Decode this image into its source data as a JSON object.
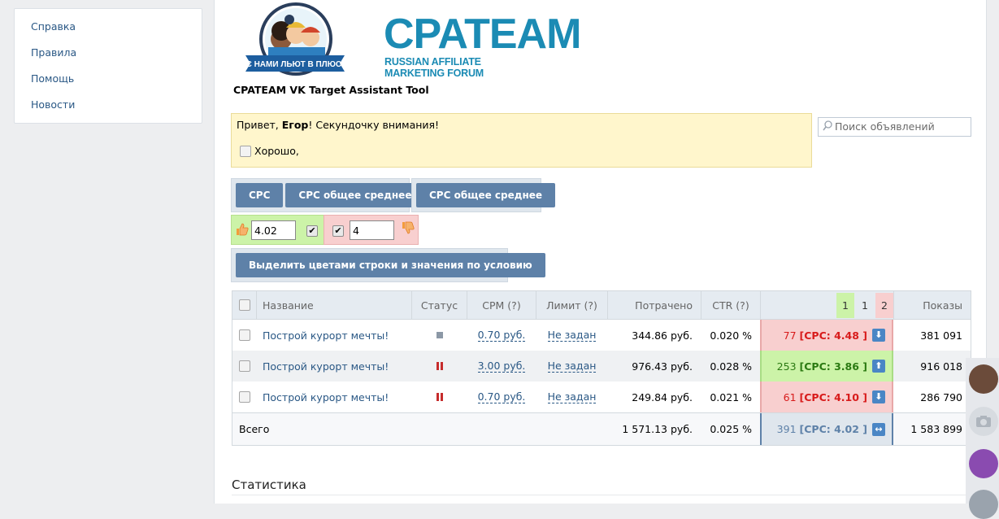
{
  "leftnav": {
    "items": [
      {
        "label": "Справка"
      },
      {
        "label": "Правила"
      },
      {
        "label": "Помощь"
      },
      {
        "label": "Новости"
      }
    ]
  },
  "logo": {
    "brand": "CPATEAM",
    "subtitle": "RUSSIAN AFFILIATE MARKETING FORUM",
    "ribbon": "С НАМИ ЛЬЮТ В ПЛЮС!"
  },
  "tool_title": "CPATEAM VK Target Assistant Tool",
  "notice": {
    "greeting_prefix": "Привет, ",
    "name": "Егор",
    "greeting_suffix": "! Секундочку внимания!",
    "ok_label": "Хорошо,"
  },
  "search": {
    "placeholder": "Поиск объявлений"
  },
  "buttons": {
    "cpc": "CPC",
    "cpc_avg": "CPC общее среднее",
    "cpc_avg2": "CPC общее среднее",
    "highlight": "Выделить цветами строки и значения по условию"
  },
  "thresholds": {
    "good_value": "4.02",
    "bad_value": "4"
  },
  "table": {
    "headers": {
      "name": "Название",
      "status": "Статус",
      "cpm": "CPM (?)",
      "limit": "Лимит (?)",
      "spent": "Потрачено",
      "ctr": "CTR (?)",
      "bid_tabs": [
        "1",
        "1",
        "2"
      ],
      "views": "Показы"
    },
    "rows": [
      {
        "name": "Построй курорт мечты!",
        "status": "stopped",
        "cpm": "0.70 руб.",
        "limit": "Не задан",
        "spent": "344.86 руб.",
        "ctr": "0.020 %",
        "bid_count": "77",
        "bid_cpc": "[CPC: 4.48 ]",
        "arrow": "down",
        "views": "381 091"
      },
      {
        "name": "Построй курорт мечты!",
        "status": "paused",
        "cpm": "3.00 руб.",
        "limit": "Не задан",
        "spent": "976.43 руб.",
        "ctr": "0.028 %",
        "bid_count": "253",
        "bid_cpc": "[CPC: 3.86 ]",
        "arrow": "up",
        "views": "916 018"
      },
      {
        "name": "Построй курорт мечты!",
        "status": "paused",
        "cpm": "0.70 руб.",
        "limit": "Не задан",
        "spent": "249.84 руб.",
        "ctr": "0.021 %",
        "bid_count": "61",
        "bid_cpc": "[CPC: 4.10 ]",
        "arrow": "down",
        "views": "286 790"
      }
    ],
    "total": {
      "label": "Всего",
      "spent": "1 571.13 руб.",
      "ctr": "0.025 %",
      "bid_count": "391",
      "bid_cpc": "[CPC: 4.02 ]",
      "views": "1 583 899"
    }
  },
  "stats_title": "Статистика",
  "colors": {
    "link": "#2a5885",
    "button": "#5e81a8",
    "good": "#ccf3a8",
    "bad": "#f8cfcf",
    "brand": "#1b8bb4"
  }
}
